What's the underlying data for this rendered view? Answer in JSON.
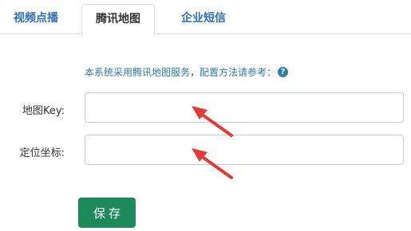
{
  "tabs": [
    {
      "label": "视频点播",
      "active": false
    },
    {
      "label": "腾讯地图",
      "active": true
    },
    {
      "label": "企业短信",
      "active": false
    }
  ],
  "info": {
    "text": "本系统采用腾讯地图服务，配置方法请参考：",
    "help_icon": "question-circle-icon",
    "help_glyph": "?"
  },
  "form": {
    "map_key": {
      "label": "地图Key:",
      "value": ""
    },
    "coordinate": {
      "label": "定位坐标:",
      "value": ""
    }
  },
  "save_button": {
    "label": "保存"
  },
  "colors": {
    "tab_link": "#2f6fb6",
    "info_text": "#2e7ea8",
    "save_button": "#1e8a5b",
    "annotation_arrow": "#e53935"
  }
}
